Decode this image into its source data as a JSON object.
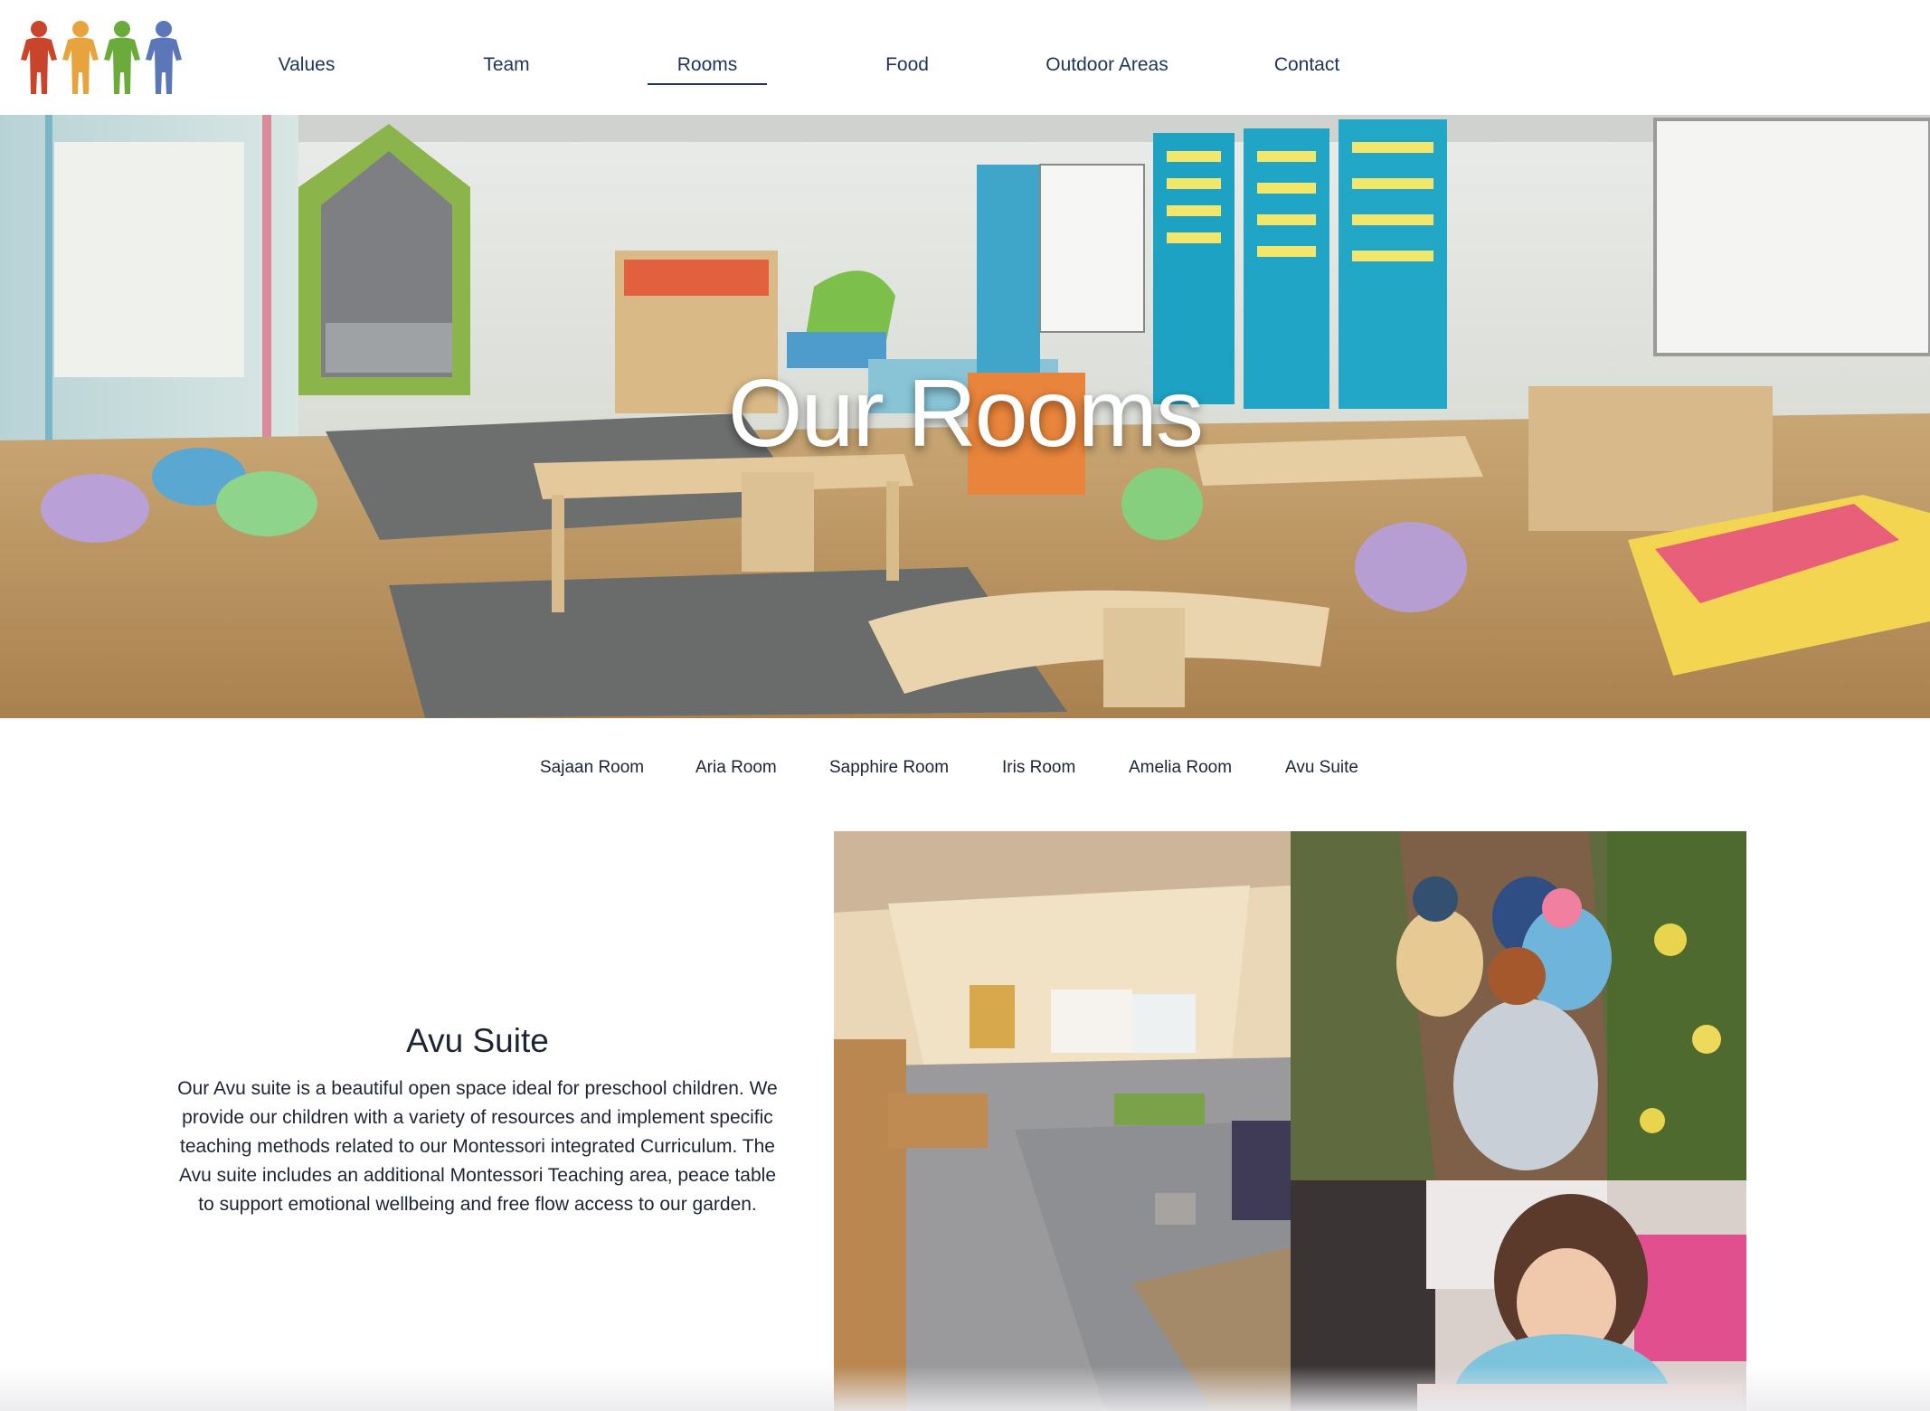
{
  "nav": {
    "items": [
      {
        "label": "Values",
        "active": false
      },
      {
        "label": "Team",
        "active": false
      },
      {
        "label": "Rooms",
        "active": true
      },
      {
        "label": "Food",
        "active": false
      },
      {
        "label": "Outdoor Areas",
        "active": false
      },
      {
        "label": "Contact",
        "active": false
      }
    ]
  },
  "logo": {
    "figures": [
      "#c8442a",
      "#e6a33e",
      "#6aab3b",
      "#5b77b8"
    ]
  },
  "hero": {
    "title": "Our Rooms"
  },
  "room_tabs": [
    "Sajaan Room",
    "Aria Room",
    "Sapphire Room",
    "Iris Room",
    "Amelia Room",
    "Avu Suite"
  ],
  "room": {
    "title": "Avu Suite",
    "description": "Our Avu suite is a beautiful open space ideal for preschool children. We provide our children with a variety of resources and implement specific teaching methods related to our Montessori integrated Curriculum. The Avu suite includes an additional Montessori Teaching area, peace table to support emotional wellbeing and free flow access to our garden."
  },
  "colors": {
    "nav_text": "#1e3557",
    "body_text": "#1d2433",
    "background": "#ffffff"
  }
}
